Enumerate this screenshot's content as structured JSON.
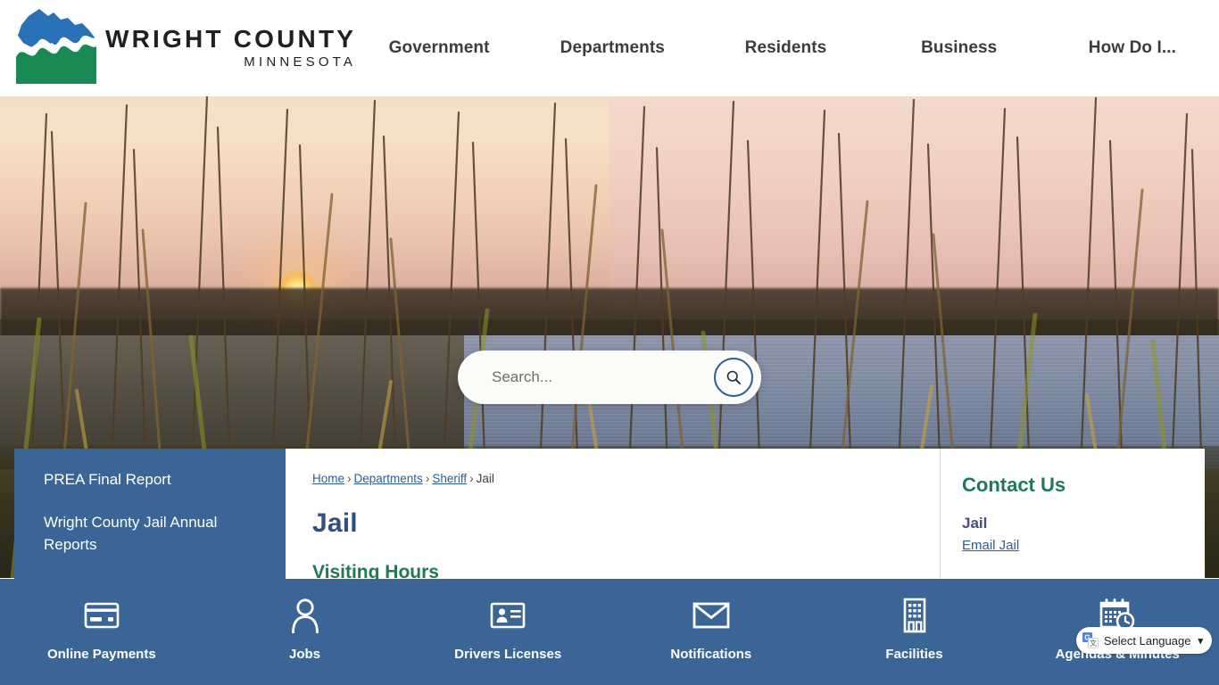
{
  "site": {
    "logo_title": "WRIGHT COUNTY",
    "logo_subtitle": "MINNESOTA",
    "logo_icon": "wright-county-logo-icon"
  },
  "nav": {
    "items": [
      {
        "label": "Government"
      },
      {
        "label": "Departments"
      },
      {
        "label": "Residents"
      },
      {
        "label": "Business"
      },
      {
        "label": "How Do I..."
      }
    ]
  },
  "search": {
    "placeholder": "Search...",
    "value": "",
    "button_icon": "search-icon"
  },
  "sidebar": {
    "items": [
      {
        "label": "PREA Final Report"
      },
      {
        "label": "Wright County Jail Annual Reports"
      }
    ]
  },
  "breadcrumb": {
    "items": [
      {
        "label": "Home",
        "link": true
      },
      {
        "label": "Departments",
        "link": true
      },
      {
        "label": "Sheriff",
        "link": true
      },
      {
        "label": "Jail",
        "link": false
      }
    ],
    "separator": "›"
  },
  "main": {
    "title": "Jail",
    "section_heading": "Visiting Hours"
  },
  "contact": {
    "title": "Contact Us",
    "name": "Jail",
    "email_link": "Email Jail"
  },
  "quicklinks": {
    "items": [
      {
        "label": "Online Payments",
        "icon": "credit-card-icon"
      },
      {
        "label": "Jobs",
        "icon": "person-icon"
      },
      {
        "label": "Drivers Licenses",
        "icon": "id-card-icon"
      },
      {
        "label": "Notifications",
        "icon": "envelope-icon"
      },
      {
        "label": "Facilities",
        "icon": "building-icon"
      },
      {
        "label": "Agendas & Minutes",
        "icon": "calendar-clock-icon"
      }
    ]
  },
  "translate": {
    "label": "Select Language",
    "caret": "∨",
    "icon": "google-translate-icon"
  },
  "colors": {
    "brand_blue": "#3b6596",
    "logo_blue": "#2a72b8",
    "logo_green": "#1a8a55",
    "heading_green": "#1d7a52",
    "title_blue": "#31507f",
    "link_blue": "#2b5d93"
  }
}
